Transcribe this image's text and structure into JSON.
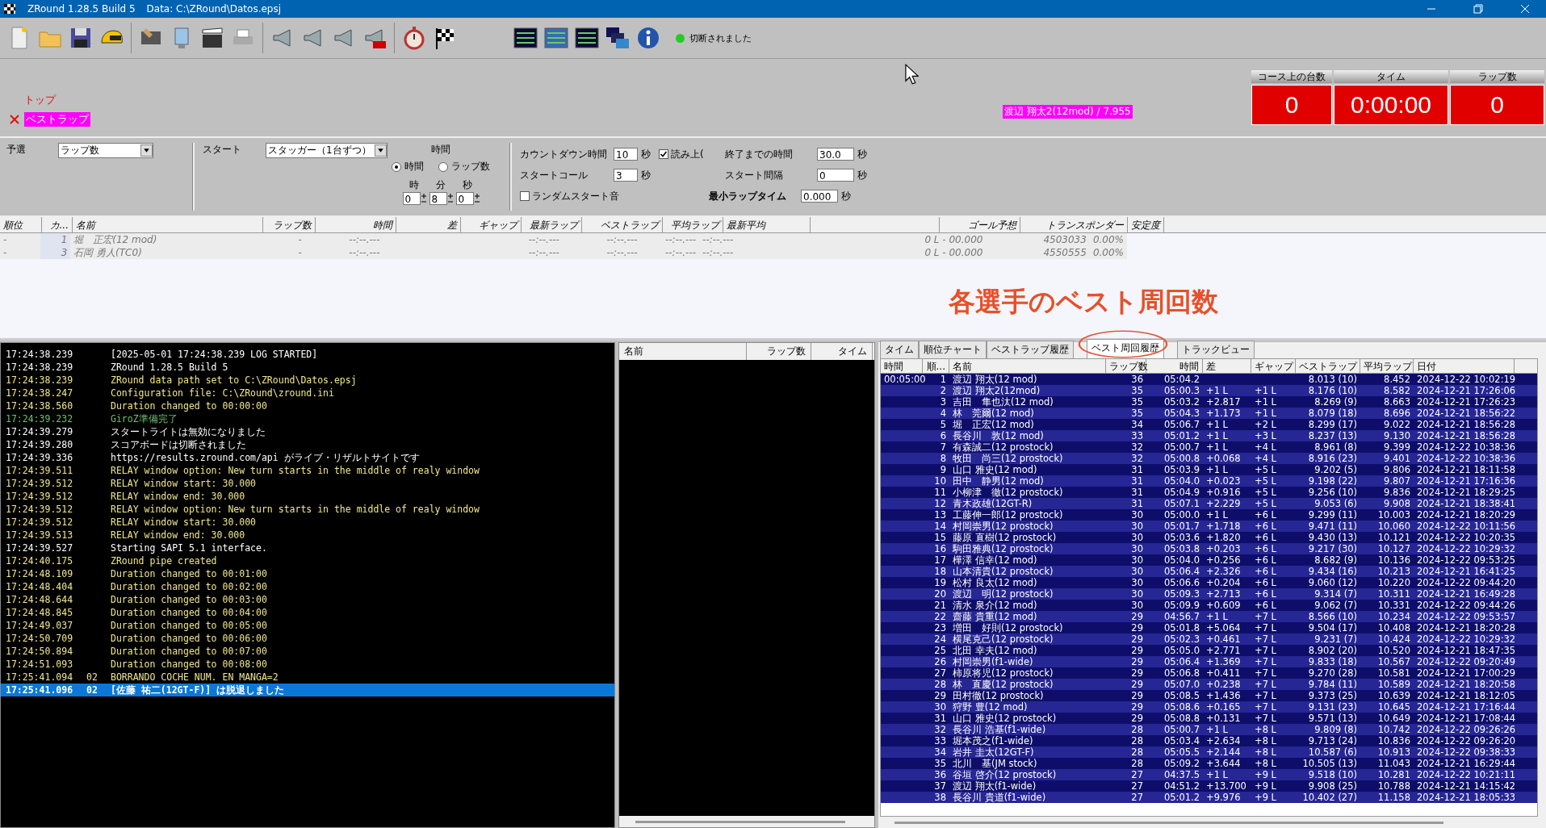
{
  "window": {
    "title": "ZRound 1.28.5 Build 5",
    "data_path": "Data: C:\\ZRound\\Datos.epsj"
  },
  "status": {
    "text": "切断されました",
    "connected": false
  },
  "banner": {
    "top_label": "トップ",
    "best_lap_label": "ベストラップ",
    "best_lap_info": "渡辺 翔太2(12mod) / 7.955"
  },
  "scoreboard": [
    {
      "label": "コース上の台数",
      "value": "0"
    },
    {
      "label": "タイム",
      "value": "0:00:00"
    },
    {
      "label": "ラップ数",
      "value": "0"
    }
  ],
  "settings": {
    "qualifying_label": "予選",
    "qualifying_value": "ラップ数",
    "start_label": "スタート",
    "start_value": "スタッガー（1台ずつ）",
    "time_group_label": "時間",
    "modes": [
      {
        "label": "時間",
        "selected": true
      },
      {
        "label": "ラップ数",
        "selected": false
      }
    ],
    "duration": [
      {
        "label": "時",
        "value": "0"
      },
      {
        "label": "分",
        "value": "8"
      },
      {
        "label": "秒",
        "value": "0"
      }
    ],
    "countdown_label": "カウントダウン時間",
    "countdown_value": "10",
    "countdown_unit": "秒",
    "read_aloud": {
      "label": "読み上(",
      "checked": true
    },
    "end_time_label": "終了までの時間",
    "end_time_value": "30.0",
    "end_time_unit": "秒",
    "start_call_label": "スタートコール",
    "start_call_value": "3",
    "start_call_unit": "秒",
    "start_interval_label": "スタート間隔",
    "start_interval_value": "0",
    "start_interval_unit": "秒",
    "random_start_sound": {
      "label": "ランダムスタート音",
      "checked": false
    },
    "min_lap_label": "最小ラップタイム",
    "min_lap_value": "0.000",
    "min_lap_unit": "秒"
  },
  "race_table": {
    "columns": [
      "順位",
      "カ...",
      "名前",
      "ラップ数",
      "時間",
      "差",
      "ギャップ",
      "最新ラップ",
      "ベストラップ",
      "平均ラップ",
      "最新平均",
      null,
      "ゴール予想",
      "トランスポンダー",
      "安定度"
    ],
    "rows": [
      [
        "-",
        "1",
        "堀　正宏(12 mod)",
        "-",
        "--:--.---",
        null,
        null,
        "--:--.---",
        "--:--.---",
        "--:--.---",
        "--:--.---",
        null,
        "0 L - 00.000",
        "4503033",
        "0.00%"
      ],
      [
        "-",
        "3",
        "石岡 勇人(TC0)",
        "-",
        "--:--.---",
        null,
        null,
        "--:--.---",
        "--:--.---",
        "--:--.---",
        "--:--.---",
        null,
        "0 L - 00.000",
        "4550555",
        "0.00%"
      ]
    ]
  },
  "annotation": {
    "text": "各選手のベスト周回数"
  },
  "log": [
    {
      "time": "17:24:38.239",
      "text": "[2025-05-01 17:24:38.239 LOG STARTED]",
      "color": "#ffffff",
      "selected": false
    },
    {
      "time": "17:24:38.239",
      "text": "ZRound 1.28.5 Build 5",
      "color": "#ffffff",
      "selected": false
    },
    {
      "time": "17:24:38.239",
      "text": "ZRound data path set to C:\\ZRound\\Datos.epsj",
      "color": "#f0e68c",
      "selected": false
    },
    {
      "time": "17:24:38.247",
      "text": "Configuration file: C:\\ZRound\\zround.ini",
      "color": "#f0e68c",
      "selected": false
    },
    {
      "time": "17:24:38.560",
      "text": "Duration changed to 00:00:00",
      "color": "#f0e68c",
      "selected": false
    },
    {
      "time": "17:24:39.232",
      "text": "GiroZ準備完了",
      "color": "#6fbf6f",
      "selected": false
    },
    {
      "time": "17:24:39.279",
      "text": "スタートライトは無効になりました",
      "color": "#ffffff",
      "selected": false
    },
    {
      "time": "17:24:39.280",
      "text": "スコアボードは切断されました",
      "color": "#ffffff",
      "selected": false
    },
    {
      "time": "17:24:39.336",
      "text": "https://results.zround.com/api がライブ・リザルトサイトです",
      "color": "#ffffff",
      "selected": false
    },
    {
      "time": "17:24:39.511",
      "text": "RELAY window option: New turn starts in the middle of realy window",
      "color": "#f0e68c",
      "selected": false
    },
    {
      "time": "17:24:39.512",
      "text": "RELAY window start: 30.000",
      "color": "#f0e68c",
      "selected": false
    },
    {
      "time": "17:24:39.512",
      "text": "RELAY window end: 30.000",
      "color": "#f0e68c",
      "selected": false
    },
    {
      "time": "17:24:39.512",
      "text": "RELAY window option: New turn starts in the middle of realy window",
      "color": "#f0e68c",
      "selected": false
    },
    {
      "time": "17:24:39.512",
      "text": "RELAY window start: 30.000",
      "color": "#f0e68c",
      "selected": false
    },
    {
      "time": "17:24:39.513",
      "text": "RELAY window end: 30.000",
      "color": "#f0e68c",
      "selected": false
    },
    {
      "time": "17:24:39.527",
      "text": "Starting SAPI 5.1 interface.",
      "color": "#ffffff",
      "selected": false
    },
    {
      "time": "17:24:40.175",
      "text": "ZRound pipe created",
      "color": "#f0e68c",
      "selected": false
    },
    {
      "time": "17:24:48.109",
      "text": "Duration changed to 00:01:00",
      "color": "#f0e68c",
      "selected": false
    },
    {
      "time": "17:24:48.404",
      "text": "Duration changed to 00:02:00",
      "color": "#f0e68c",
      "selected": false
    },
    {
      "time": "17:24:48.644",
      "text": "Duration changed to 00:03:00",
      "color": "#f0e68c",
      "selected": false
    },
    {
      "time": "17:24:48.845",
      "text": "Duration changed to 00:04:00",
      "color": "#f0e68c",
      "selected": false
    },
    {
      "time": "17:24:49.037",
      "text": "Duration changed to 00:05:00",
      "color": "#f0e68c",
      "selected": false
    },
    {
      "time": "17:24:50.709",
      "text": "Duration changed to 00:06:00",
      "color": "#f0e68c",
      "selected": false
    },
    {
      "time": "17:24:50.894",
      "text": "Duration changed to 00:07:00",
      "color": "#f0e68c",
      "selected": false
    },
    {
      "time": "17:24:51.093",
      "text": "Duration changed to 00:08:00",
      "color": "#f0e68c",
      "selected": false
    },
    {
      "time": "17:25:41.094",
      "code": "02",
      "text": "BORRANDO COCHE NUM. EN MANGA=2",
      "color": "#f0e68c",
      "selected": false
    },
    {
      "time": "17:25:41.096",
      "code": "02",
      "text": "[佐藤 祐二(12GT-F)] は脱退しました",
      "selected": true
    }
  ],
  "on_track_table": {
    "columns": [
      "名前",
      "ラップ数",
      "タイム"
    ]
  },
  "history": {
    "tabs": [
      {
        "label": "タイム",
        "selected": false
      },
      {
        "label": "順位チャート",
        "selected": false
      },
      {
        "label": "ベストラップ履歴",
        "selected": false
      },
      {
        "label": "ベスト周回履歴",
        "selected": true
      },
      {
        "label": "トラックビュー",
        "selected": false
      }
    ],
    "columns": [
      "時間",
      "順...",
      "名前",
      "ラップ数",
      "時間",
      "差",
      "ギャップ",
      "ベストラップ",
      "平均ラップ",
      "日付"
    ],
    "rows": [
      [
        "00:05:00",
        "1",
        "渡辺 翔太(12 mod)",
        "36",
        "05:04.2",
        null,
        null,
        "8.013 (10)",
        "8.452",
        "2024-12-22 10:02:19"
      ],
      [
        null,
        "2",
        "渡辺 翔太2(12mod)",
        "35",
        "05:00.3",
        "+1 L",
        "+1 L",
        "8.176 (10)",
        "8.582",
        "2024-12-21 17:26:06"
      ],
      [
        null,
        "3",
        "吉田　隼也汰(12 mod)",
        "35",
        "05:03.2",
        "+2.817",
        "+1 L",
        "8.269 (9)",
        "8.663",
        "2024-12-21 17:26:23"
      ],
      [
        null,
        "4",
        "林　莞爾(12 mod)",
        "35",
        "05:04.3",
        "+1.173",
        "+1 L",
        "8.079 (18)",
        "8.696",
        "2024-12-21 18:56:22"
      ],
      [
        null,
        "5",
        "堀　正宏(12 mod)",
        "34",
        "05:06.7",
        "+1 L",
        "+2 L",
        "8.299 (17)",
        "9.022",
        "2024-12-21 18:56:28"
      ],
      [
        null,
        "6",
        "長谷川　敦(12 mod)",
        "33",
        "05:01.2",
        "+1 L",
        "+3 L",
        "8.237 (13)",
        "9.130",
        "2024-12-21 18:56:28"
      ],
      [
        null,
        "7",
        "有森誠二(12 prostock)",
        "32",
        "05:00.7",
        "+1 L",
        "+4 L",
        "8.961 (8)",
        "9.399",
        "2024-12-22 10:38:36"
      ],
      [
        null,
        "8",
        "牧田　尚三(12 prostock)",
        "32",
        "05:00.8",
        "+0.068",
        "+4 L",
        "8.916 (23)",
        "9.401",
        "2024-12-22 10:38:36"
      ],
      [
        null,
        "9",
        "山口 雅史(12 mod)",
        "31",
        "05:03.9",
        "+1 L",
        "+5 L",
        "9.202 (5)",
        "9.806",
        "2024-12-21 18:11:58"
      ],
      [
        null,
        "10",
        "田中　静男(12 mod)",
        "31",
        "05:04.0",
        "+0.023",
        "+5 L",
        "9.198 (22)",
        "9.807",
        "2024-12-21 17:16:36"
      ],
      [
        null,
        "11",
        "小柳津　徹(12 prostock)",
        "31",
        "05:04.9",
        "+0.916",
        "+5 L",
        "9.256 (10)",
        "9.836",
        "2024-12-21 18:29:25"
      ],
      [
        null,
        "12",
        "青木政雄(12GT-R)",
        "31",
        "05:07.1",
        "+2.229",
        "+5 L",
        "9.053 (6)",
        "9.908",
        "2024-12-21 18:38:41"
      ],
      [
        null,
        "13",
        "工藤伸一郎(12 prostock)",
        "30",
        "05:00.0",
        "+1 L",
        "+6 L",
        "9.299 (11)",
        "10.003",
        "2024-12-21 18:20:29"
      ],
      [
        null,
        "14",
        "村岡崇男(12 prostock)",
        "30",
        "05:01.7",
        "+1.718",
        "+6 L",
        "9.471 (11)",
        "10.060",
        "2024-12-22 10:11:56"
      ],
      [
        null,
        "15",
        "藤原 直樹(12 prostock)",
        "30",
        "05:03.6",
        "+1.820",
        "+6 L",
        "9.430 (13)",
        "10.121",
        "2024-12-22 10:20:35"
      ],
      [
        null,
        "16",
        "駒田雅典(12 prostock)",
        "30",
        "05:03.8",
        "+0.203",
        "+6 L",
        "9.217 (30)",
        "10.127",
        "2024-12-22 10:29:32"
      ],
      [
        null,
        "17",
        "樺澤 信幸(12 mod)",
        "30",
        "05:04.0",
        "+0.256",
        "+6 L",
        "8.682 (9)",
        "10.136",
        "2024-12-22 09:53:25"
      ],
      [
        null,
        "18",
        "山本清貴(12 prostock)",
        "30",
        "05:06.4",
        "+2.326",
        "+6 L",
        "9.434 (16)",
        "10.213",
        "2024-12-21 16:41:25"
      ],
      [
        null,
        "19",
        "松村 良太(12 mod)",
        "30",
        "05:06.6",
        "+0.204",
        "+6 L",
        "9.060 (12)",
        "10.220",
        "2024-12-22 09:44:20"
      ],
      [
        null,
        "20",
        "渡辺　明(12 prostock)",
        "30",
        "05:09.3",
        "+2.713",
        "+6 L",
        "9.314 (7)",
        "10.311",
        "2024-12-21 16:49:28"
      ],
      [
        null,
        "21",
        "清水 泉介(12 mod)",
        "30",
        "05:09.9",
        "+0.609",
        "+6 L",
        "9.062 (7)",
        "10.331",
        "2024-12-22 09:44:26"
      ],
      [
        null,
        "22",
        "齋藤 貴重(12 mod)",
        "29",
        "04:56.7",
        "+1 L",
        "+7 L",
        "8.566 (10)",
        "10.234",
        "2024-12-22 09:53:57"
      ],
      [
        null,
        "23",
        "増田　好則(12 prostock)",
        "29",
        "05:01.8",
        "+5.064",
        "+7 L",
        "9.504 (17)",
        "10.408",
        "2024-12-21 18:20:28"
      ],
      [
        null,
        "24",
        "横尾克己(12 prostock)",
        "29",
        "05:02.3",
        "+0.461",
        "+7 L",
        "9.231 (7)",
        "10.424",
        "2024-12-22 10:29:32"
      ],
      [
        null,
        "25",
        "北田 幸夫(12 mod)",
        "29",
        "05:05.0",
        "+2.771",
        "+7 L",
        "8.902 (20)",
        "10.520",
        "2024-12-21 18:47:35"
      ],
      [
        null,
        "26",
        "村岡崇男(f1-wide)",
        "29",
        "05:06.4",
        "+1.369",
        "+7 L",
        "9.833 (18)",
        "10.567",
        "2024-12-22 09:20:49"
      ],
      [
        null,
        "27",
        "柿原将児(12 prostock)",
        "29",
        "05:06.8",
        "+0.411",
        "+7 L",
        "9.270 (28)",
        "10.581",
        "2024-12-21 17:00:29"
      ],
      [
        null,
        "28",
        "林　直慶(12 prostock)",
        "29",
        "05:07.0",
        "+0.238",
        "+7 L",
        "9.784 (11)",
        "10.589",
        "2024-12-21 18:20:58"
      ],
      [
        null,
        "29",
        "田村徹(12 prostock)",
        "29",
        "05:08.5",
        "+1.436",
        "+7 L",
        "9.373 (25)",
        "10.639",
        "2024-12-21 18:12:05"
      ],
      [
        null,
        "30",
        "狩野 豊(12 mod)",
        "29",
        "05:08.6",
        "+0.165",
        "+7 L",
        "9.131 (23)",
        "10.645",
        "2024-12-21 17:16:44"
      ],
      [
        null,
        "31",
        "山口 雅史(12 prostock)",
        "29",
        "05:08.8",
        "+0.131",
        "+7 L",
        "9.571 (13)",
        "10.649",
        "2024-12-21 17:08:44"
      ],
      [
        null,
        "32",
        "長谷川 浩基(f1-wide)",
        "28",
        "05:00.7",
        "+1 L",
        "+8 L",
        "9.809 (8)",
        "10.742",
        "2024-12-22 09:26:26"
      ],
      [
        null,
        "33",
        "堀本茂之(f1-wide)",
        "28",
        "05:03.4",
        "+2.634",
        "+8 L",
        "9.713 (24)",
        "10.836",
        "2024-12-22 09:26:20"
      ],
      [
        null,
        "34",
        "岩井 圭太(12GT-F)",
        "28",
        "05:05.5",
        "+2.144",
        "+8 L",
        "10.587 (6)",
        "10.913",
        "2024-12-22 09:38:33"
      ],
      [
        null,
        "35",
        "北川　基(JM stock)",
        "28",
        "05:09.2",
        "+3.644",
        "+8 L",
        "10.505 (13)",
        "11.043",
        "2024-12-21 16:29:44"
      ],
      [
        null,
        "36",
        "谷垣 啓介(12 prostock)",
        "27",
        "04:37.5",
        "+1 L",
        "+9 L",
        "9.518 (10)",
        "10.281",
        "2024-12-22 10:21:11"
      ],
      [
        null,
        "37",
        "渡辺 翔太(f1-wide)",
        "27",
        "04:51.2",
        "+13.700",
        "+9 L",
        "9.908 (25)",
        "10.788",
        "2024-12-21 14:15:42"
      ],
      [
        null,
        "38",
        "長谷川 貴道(f1-wide)",
        "27",
        "05:01.2",
        "+9.976",
        "+9 L",
        "10.402 (27)",
        "11.158",
        "2024-12-21 18:05:33"
      ]
    ]
  }
}
